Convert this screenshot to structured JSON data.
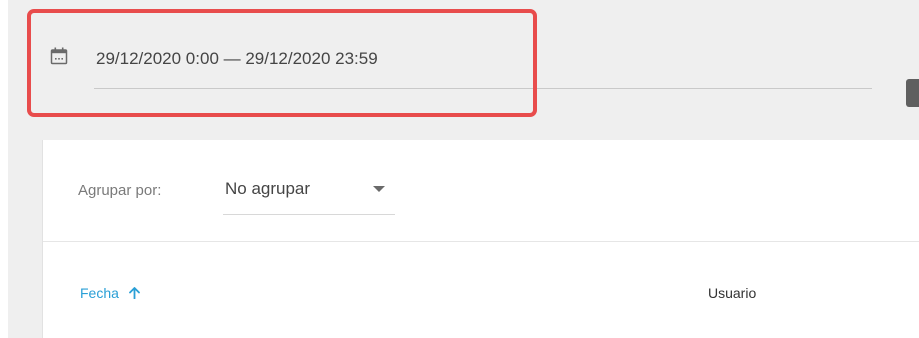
{
  "filter": {
    "date_range": "29/12/2020 0:00 — 29/12/2020 23:59",
    "icon": "calendar-icon"
  },
  "grouping": {
    "label": "Agrupar por:",
    "selected": "No agrupar",
    "icon": "caret-down-icon"
  },
  "table": {
    "columns": [
      {
        "label": "Fecha",
        "sorted": "ascending",
        "icon": "arrow-up-icon",
        "color": "#2a9fd6"
      },
      {
        "label": "Usuario"
      }
    ]
  },
  "colors": {
    "highlight": "#e84c4c",
    "accent": "#2a9fd6",
    "background": "#efefef"
  }
}
